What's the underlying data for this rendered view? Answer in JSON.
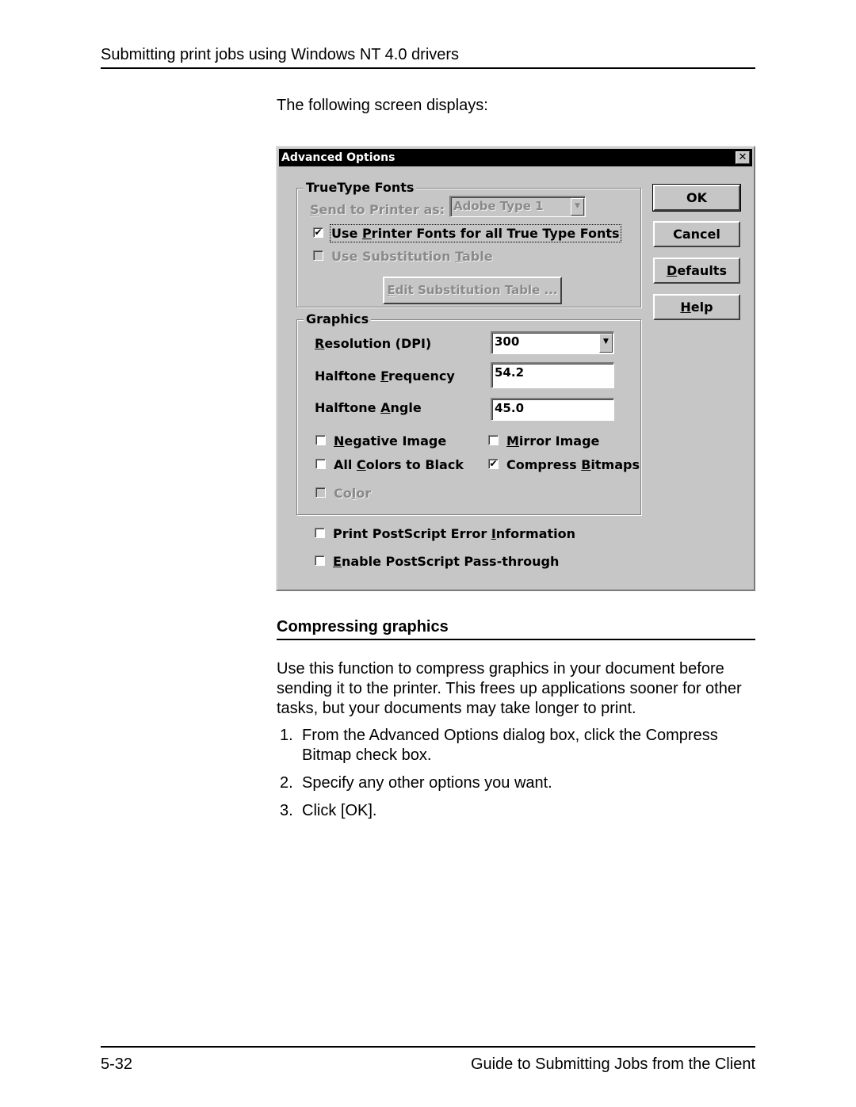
{
  "header": {
    "running_title": "Submitting print jobs using Windows NT 4.0 drivers"
  },
  "intro_text": "The following screen displays:",
  "dialog": {
    "title": "Advanced Options",
    "close_glyph": "✕",
    "truetype_group": {
      "legend": "TrueType Fonts",
      "send_label_pre": "",
      "send_label_u": "S",
      "send_label_post": "end to Printer as:",
      "send_value": "Adobe Type 1",
      "use_printer_fonts": {
        "pre": "Use ",
        "u": "P",
        "post": "rinter Fonts for all True Type Fonts",
        "checked": true
      },
      "use_substitution": {
        "pre": "Use Substitution ",
        "u": "T",
        "post": "able",
        "checked": false,
        "disabled": true
      },
      "edit_button": {
        "pre": "",
        "u": "E",
        "post": "dit Substitution Table ..."
      }
    },
    "graphics_group": {
      "legend": "Graphics",
      "resolution": {
        "pre": "",
        "u": "R",
        "post": "esolution (DPI)",
        "value": "300"
      },
      "frequency": {
        "pre": "Halftone ",
        "u": "F",
        "post": "requency",
        "value": "54.2"
      },
      "angle": {
        "pre": "Halftone ",
        "u": "A",
        "post": "ngle",
        "value": "45.0"
      },
      "negative": {
        "pre": "",
        "u": "N",
        "post": "egative Image",
        "checked": false
      },
      "mirror": {
        "pre": "",
        "u": "M",
        "post": "irror Image",
        "checked": false
      },
      "all_black": {
        "pre": "All ",
        "u": "C",
        "post": "olors to Black",
        "checked": false
      },
      "compress": {
        "pre": "Compress ",
        "u": "B",
        "post": "itmaps",
        "checked": true
      },
      "color": {
        "pre": "Co",
        "u": "l",
        "post": "or",
        "checked": false,
        "disabled": true
      }
    },
    "ps_error": {
      "pre": "Print PostScript Error ",
      "u": "I",
      "post": "nformation",
      "checked": false
    },
    "ps_passthrough": {
      "pre": "",
      "u": "E",
      "post": "nable PostScript Pass-through",
      "checked": false
    },
    "buttons": {
      "ok": {
        "pre": "OK",
        "u": "",
        "post": ""
      },
      "cancel": {
        "pre": "Cancel",
        "u": "",
        "post": ""
      },
      "defaults": {
        "pre": "",
        "u": "D",
        "post": "efaults"
      },
      "help": {
        "pre": "",
        "u": "H",
        "post": "elp"
      }
    },
    "check_glyph": "✔"
  },
  "section": {
    "title": "Compressing graphics",
    "paragraph": "Use this function to compress graphics in your document before sending it to the printer. This frees up applications sooner for other tasks, but your documents may take longer to print.",
    "steps": [
      {
        "num": "1.",
        "text": "From the Advanced Options dialog box, click the Compress Bitmap check box."
      },
      {
        "num": "2.",
        "text": "Specify any other options you want."
      },
      {
        "num": "3.",
        "text": "Click [OK]."
      }
    ]
  },
  "footer": {
    "page_number": "5-32",
    "book_title": "Guide to Submitting Jobs from the Client"
  }
}
